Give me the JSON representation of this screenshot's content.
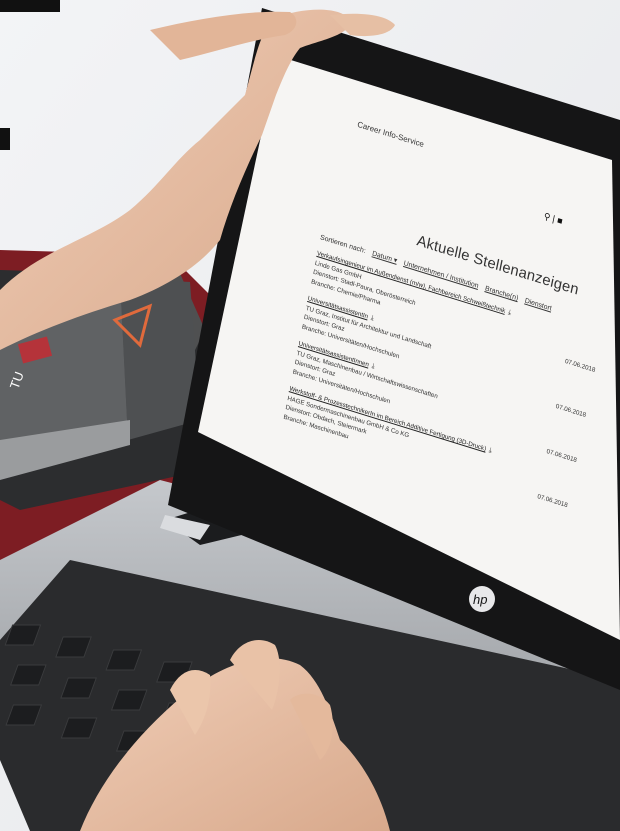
{
  "site": {
    "name": "Career Info-Service"
  },
  "header": {
    "search_icon": "search-icon",
    "user_icon": "user-icon"
  },
  "page": {
    "title": "Aktuelle Stellenanzeigen"
  },
  "sort": {
    "label": "Sortieren nach:",
    "options": [
      "Datum ▾",
      "Unternehmen / Institution",
      "Branche(n)",
      "Dienstort"
    ]
  },
  "listings": [
    {
      "title": "Verkaufsingenieur im Außendienst (m/w), Fachbereich Schweißtechnik",
      "company": "Linde Gas GmbH",
      "location": "Dienstort: Stadl-Paura, Oberösterreich",
      "branch": "Branche: Chemie/Pharma",
      "date": "07.06.2018"
    },
    {
      "title": "UniversitätsassistentIn",
      "company": "TU Graz, Institut für Architektur und Landschaft",
      "location": "Dienstort: Graz",
      "branch": "Branche: Universitäten/Hochschulen",
      "date": "07.06.2018"
    },
    {
      "title": "UniversitätsassistentInnen",
      "company": "TU Graz, Maschinenbau / Wirtschaftswissenschaften",
      "location": "Dienstort: Graz",
      "branch": "Branche: Universitäten/Hochschulen",
      "date": "07.06.2018"
    },
    {
      "title": "Werkstoff- & ProzesstechnikerIn im Bereich Additive Fertigung (3D-Druck)",
      "company": "HAGE Sondermaschinenbau GmbH & Co KG",
      "location": "Dienstort: Obdach, Steiermark",
      "branch": "Branche: Maschinenbau",
      "date": "07.06.2018"
    }
  ],
  "scene": {
    "laptop_brand_logo": "hp",
    "book_label": "TU Graz",
    "colors": {
      "screen": "#f6f5f3",
      "bezel": "#151516",
      "laptop": "#a7aaae",
      "keys": "#1c1d1f",
      "skin": "#e7c2a8",
      "book_red": "#b5333a"
    }
  }
}
